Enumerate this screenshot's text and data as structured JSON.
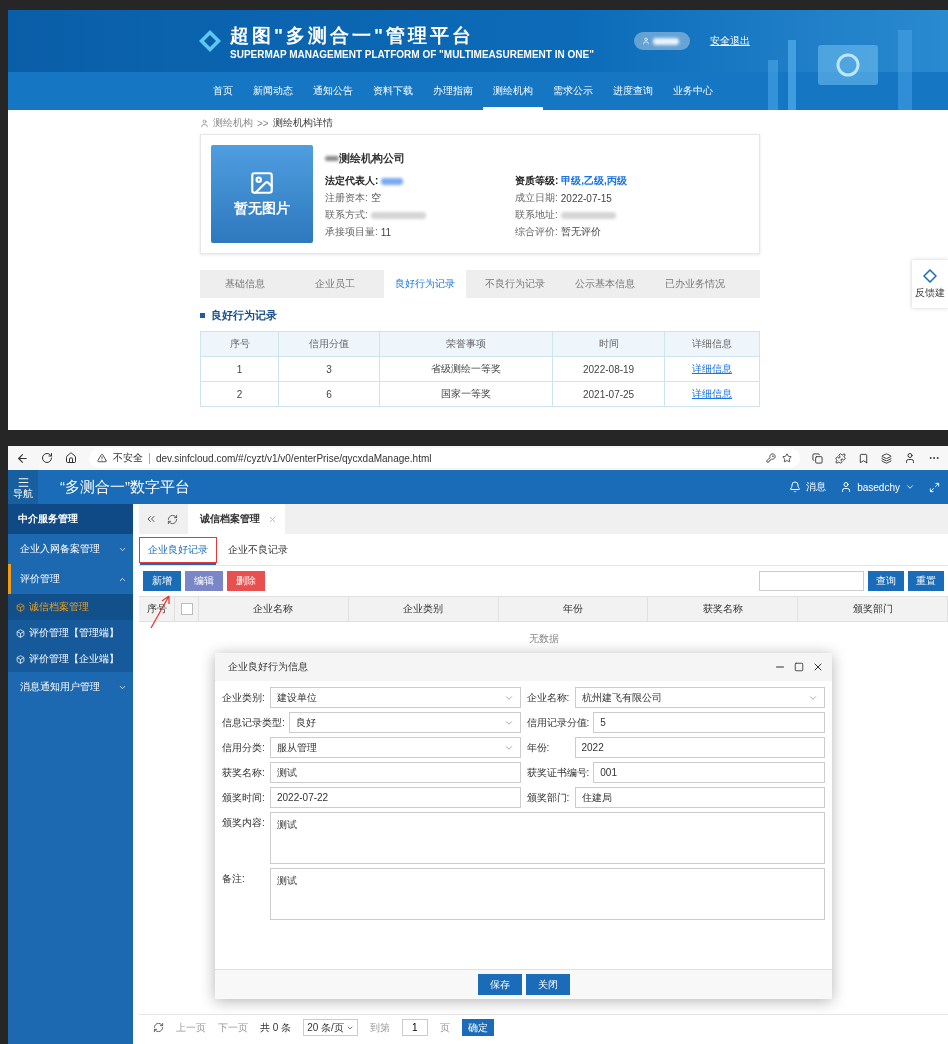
{
  "portal": {
    "logo_title": "超图\"多测合一\"管理平台",
    "logo_subtitle": "SUPERMAP MANAGEMENT PLATFORM OF \"MULTIMEASUREMENT IN ONE\"",
    "logout": "安全退出",
    "nav": [
      {
        "label": "首页",
        "selected": false
      },
      {
        "label": "新闻动态",
        "selected": false
      },
      {
        "label": "通知公告",
        "selected": false
      },
      {
        "label": "资料下载",
        "selected": false
      },
      {
        "label": "办理指南",
        "selected": false
      },
      {
        "label": "测绘机构",
        "selected": true
      },
      {
        "label": "需求公示",
        "selected": false
      },
      {
        "label": "进度查询",
        "selected": false
      },
      {
        "label": "业务中心",
        "selected": false
      }
    ],
    "breadcrumb": [
      "测绘机构",
      ">>",
      "测绘机构详情"
    ],
    "company": {
      "photo_text": "暂无图片",
      "name": "测绘机构公司",
      "fields_left": [
        {
          "label": "法定代表人:",
          "emphasis": true,
          "redacted": true
        },
        {
          "label": "注册资本:",
          "value": "空",
          "emphasis": false,
          "redacted": false
        },
        {
          "label": "联系方式:",
          "emphasis": false,
          "redacted": true
        },
        {
          "label": "承接项目量:",
          "value": "11",
          "emphasis": false,
          "redacted": false
        }
      ],
      "fields_right": [
        {
          "label": "资质等级:",
          "value": "甲级,乙级,丙级",
          "emphasis": true,
          "redacted": false
        },
        {
          "label": "成立日期:",
          "value": "2022-07-15",
          "emphasis": false,
          "redacted": false
        },
        {
          "label": "联系地址:",
          "emphasis": false,
          "redacted": true
        },
        {
          "label": "综合评价:",
          "value": "暂无评价",
          "emphasis": false,
          "redacted": false
        }
      ]
    },
    "tabs": [
      {
        "label": "基础信息",
        "selected": false
      },
      {
        "label": "企业员工",
        "selected": false
      },
      {
        "label": "良好行为记录",
        "selected": true
      },
      {
        "label": "不良行为记录",
        "selected": false
      },
      {
        "label": "公示基本信息",
        "selected": false
      },
      {
        "label": "已办业务情况",
        "selected": false
      }
    ],
    "section_title": "良好行为记录",
    "table": {
      "columns": [
        "序号",
        "信用分值",
        "荣誉事项",
        "时间",
        "详细信息"
      ],
      "rows": [
        [
          "1",
          "3",
          "省级测绘一等奖",
          "2022-08-19",
          "详细信息"
        ],
        [
          "2",
          "6",
          "国家一等奖",
          "2021-07-25",
          "详细信息"
        ]
      ]
    },
    "feedback": "反馈建"
  },
  "browser": {
    "security": "不安全",
    "url": "dev.sinfcloud.com/#/cyzt/v1/v0/enterPrise/qycxdaManage.html"
  },
  "app": {
    "nav_label": "导航",
    "title": "“多测合一”数字平台",
    "messages": "消息",
    "user": "basedchy",
    "sidebar": {
      "header": "中介服务管理",
      "items": [
        {
          "label": "企业入网备案管理",
          "expanded": false
        },
        {
          "label": "评价管理",
          "expanded": true,
          "children": [
            {
              "label": "诚信档案管理",
              "selected": true
            },
            {
              "label": "评价管理【管理端】",
              "selected": false
            },
            {
              "label": "评价管理【企业端】",
              "selected": false
            }
          ]
        },
        {
          "label": "消息通知用户管理",
          "expanded": false
        }
      ]
    },
    "page_tab": "诚信档案管理",
    "sub_tabs": [
      {
        "label": "企业良好记录",
        "selected": true
      },
      {
        "label": "企业不良记录",
        "selected": false
      }
    ],
    "actions": [
      {
        "label": "新增",
        "kind": "primary"
      },
      {
        "label": "编辑",
        "kind": "secondary"
      },
      {
        "label": "删除",
        "kind": "danger"
      }
    ],
    "search_buttons": [
      "查询",
      "重置"
    ],
    "select_all": {
      "checked": false
    },
    "columns": [
      "序号",
      "企业名称",
      "企业类别",
      "年份",
      "获奖名称",
      "颁奖部门"
    ],
    "empty": "无数据",
    "pager": {
      "prev": "上一页",
      "next": "下一页",
      "total": "共 0 条",
      "page_size": "20 条/页",
      "goto": "到第",
      "page": "1",
      "page_unit": "页",
      "confirm": "确定"
    },
    "dialog": {
      "title": "企业良好行为信息",
      "fields": [
        {
          "label": "企业类别:",
          "value": "建设单位",
          "kind": "select"
        },
        {
          "label": "企业名称:",
          "value": "杭州建飞有限公司",
          "kind": "select"
        },
        {
          "label": "信息记录类型:",
          "value": "良好",
          "kind": "select"
        },
        {
          "label": "信用记录分值:",
          "value": "5",
          "kind": "input"
        },
        {
          "label": "信用分类:",
          "value": "服从管理",
          "kind": "select"
        },
        {
          "label": "年份:",
          "value": "2022",
          "kind": "input"
        },
        {
          "label": "获奖名称:",
          "value": "测试",
          "kind": "input"
        },
        {
          "label": "获奖证书编号:",
          "value": "001",
          "kind": "input"
        },
        {
          "label": "颁奖时间:",
          "value": "2022-07-22",
          "kind": "input"
        },
        {
          "label": "颁奖部门:",
          "value": "住建局",
          "kind": "input"
        },
        {
          "label": "颁奖内容:",
          "value": "测试",
          "kind": "textarea"
        },
        {
          "label": "备注:",
          "value": "测试",
          "kind": "textarea"
        }
      ],
      "buttons": [
        "保存",
        "关闭"
      ]
    }
  }
}
